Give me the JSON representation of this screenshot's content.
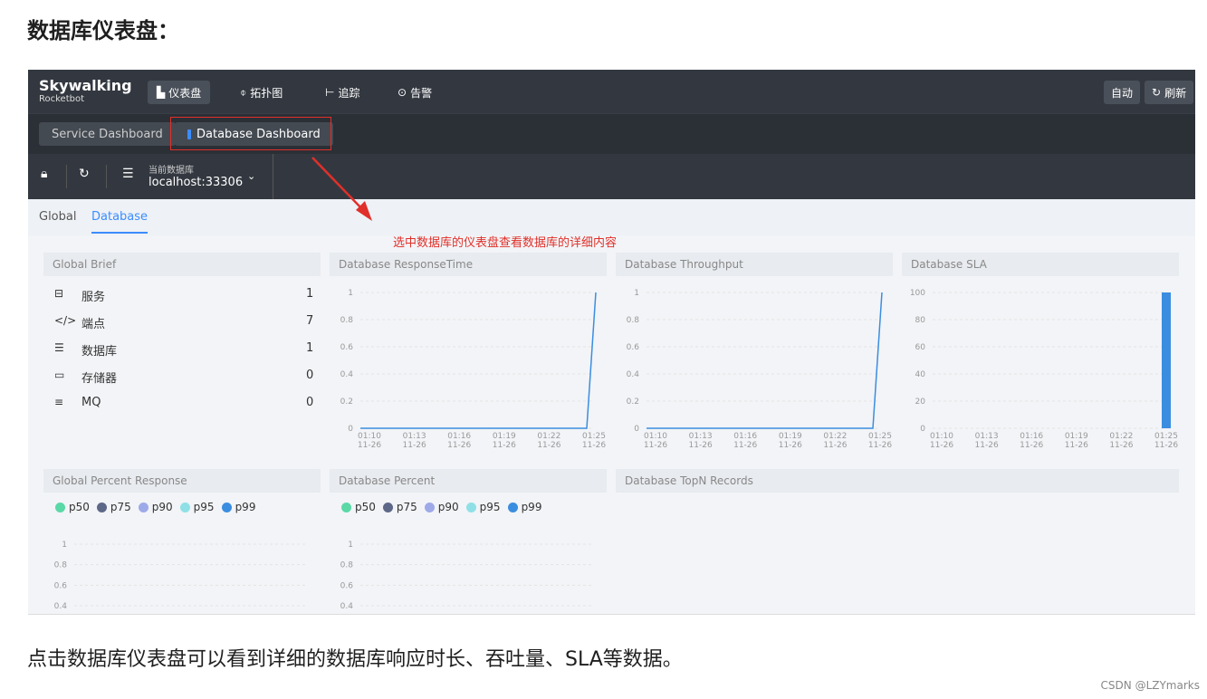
{
  "heading": "数据库仪表盘：",
  "caption": "点击数据库仪表盘可以看到详细的数据库响应时长、吞吐量、SLA等数据。",
  "credit": "CSDN @LZYmarks",
  "app": {
    "logo_title": "Skywalking",
    "logo_sub": "Rocketbot",
    "nav": [
      {
        "label": "仪表盘",
        "icon": "bar-chart-icon"
      },
      {
        "label": "拓扑图",
        "icon": "topology-icon"
      },
      {
        "label": "追踪",
        "icon": "trace-icon"
      },
      {
        "label": "告警",
        "icon": "alarm-icon"
      }
    ],
    "auto_label": "自动",
    "refresh_label": "刷新"
  },
  "tabs": [
    {
      "label": "Service Dashboard"
    },
    {
      "label": "Database Dashboard"
    }
  ],
  "selector": {
    "label": "当前数据库",
    "value": "localhost:33306"
  },
  "subtabs": [
    {
      "label": "Global"
    },
    {
      "label": "Database"
    }
  ],
  "annotation": "选中数据库的仪表盘查看数据库的详细内容",
  "panels": {
    "global_brief": "Global Brief",
    "response_time": "Database ResponseTime",
    "throughput": "Database Throughput",
    "sla": "Database SLA",
    "global_percent": "Global Percent Response",
    "database_percent": "Database Percent",
    "topn": "Database TopN Records"
  },
  "brief": [
    {
      "icon": "service-icon",
      "glyph": "⊟",
      "label": "服务",
      "value": "1"
    },
    {
      "icon": "endpoint-icon",
      "glyph": "</>",
      "label": "端点",
      "value": "7"
    },
    {
      "icon": "database-icon",
      "glyph": "☰",
      "label": "数据库",
      "value": "1"
    },
    {
      "icon": "storage-icon",
      "glyph": "▭",
      "label": "存储器",
      "value": "0"
    },
    {
      "icon": "mq-icon",
      "glyph": "≡",
      "label": "MQ",
      "value": "0"
    }
  ],
  "legend": [
    {
      "label": "p50",
      "color": "#5ad8a6"
    },
    {
      "label": "p75",
      "color": "#5d6787"
    },
    {
      "label": "p90",
      "color": "#9ea9e8"
    },
    {
      "label": "p95",
      "color": "#8fe0e6"
    },
    {
      "label": "p99",
      "color": "#3b8de0"
    }
  ],
  "chart_data": [
    {
      "type": "line",
      "x": [
        "01:10\n11-26",
        "01:13\n11-26",
        "01:16\n11-26",
        "01:19\n11-26",
        "01:22\n11-26",
        "01:25\n11-26"
      ],
      "ylim": [
        0,
        1
      ],
      "yticks": [
        "1",
        "0.8",
        "0.6",
        "0.4",
        "0.2",
        "0"
      ],
      "series": [
        {
          "values": [
            0,
            0,
            0,
            0,
            0,
            0,
            0,
            1
          ]
        }
      ],
      "color": "#3b8de0"
    },
    {
      "type": "line",
      "x": [
        "01:10\n11-26",
        "01:13\n11-26",
        "01:16\n11-26",
        "01:19\n11-26",
        "01:22\n11-26",
        "01:25\n11-26"
      ],
      "ylim": [
        0,
        1
      ],
      "yticks": [
        "1",
        "0.8",
        "0.6",
        "0.4",
        "0.2",
        "0"
      ],
      "series": [
        {
          "values": [
            0,
            0,
            0,
            0,
            0,
            0,
            0,
            1
          ]
        }
      ],
      "color": "#3b8de0"
    },
    {
      "type": "bar",
      "x": [
        "01:10\n11-26",
        "01:13\n11-26",
        "01:16\n11-26",
        "01:19\n11-26",
        "01:22\n11-26",
        "01:25\n11-26"
      ],
      "ylim": [
        0,
        100
      ],
      "yticks": [
        "100",
        "80",
        "60",
        "40",
        "20",
        "0"
      ],
      "series": [
        {
          "values": [
            0,
            0,
            0,
            0,
            0,
            0,
            0,
            100
          ]
        }
      ],
      "color": "#3b8de0"
    },
    {
      "type": "line",
      "x": [],
      "ylim": [
        0.4,
        1
      ],
      "yticks": [
        "1",
        "0.8",
        "0.6",
        "0.4"
      ],
      "series": []
    },
    {
      "type": "line",
      "x": [],
      "ylim": [
        0.4,
        1
      ],
      "yticks": [
        "1",
        "0.8",
        "0.6",
        "0.4"
      ],
      "series": []
    }
  ]
}
